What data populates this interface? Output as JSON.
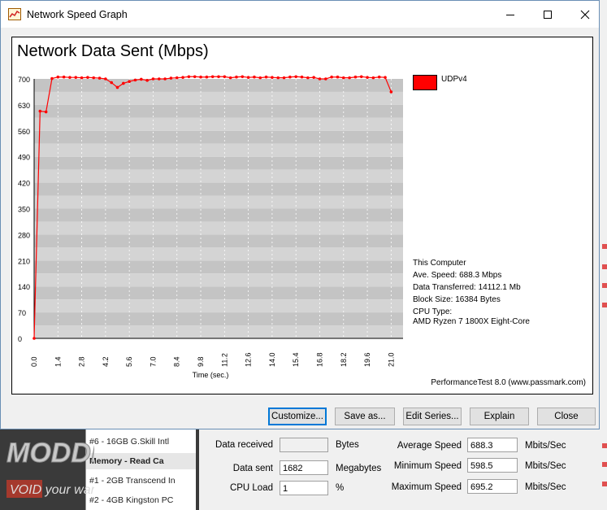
{
  "window": {
    "title": "Network Speed Graph"
  },
  "chart_data": {
    "type": "line",
    "title": "Network Data Sent (Mbps)",
    "xlabel": "Time (sec.)",
    "ylabel": "",
    "xlim": [
      0.0,
      21.7
    ],
    "ylim": [
      0,
      700
    ],
    "x_ticks": [
      "0.0",
      "1.4",
      "2.8",
      "4.2",
      "5.6",
      "7.0",
      "8.4",
      "9.8",
      "11.2",
      "12.6",
      "14.0",
      "15.4",
      "16.8",
      "18.2",
      "19.6",
      "21.0"
    ],
    "y_ticks": [
      "0",
      "70",
      "140",
      "210",
      "280",
      "350",
      "420",
      "490",
      "560",
      "630",
      "700"
    ],
    "grid": true,
    "legend_position": "top-right",
    "series": [
      {
        "name": "UDPv4",
        "color": "#ff0000",
        "x": [
          0.0,
          0.35,
          0.7,
          1.05,
          1.4,
          1.75,
          2.1,
          2.45,
          2.8,
          3.15,
          3.5,
          3.85,
          4.2,
          4.55,
          4.9,
          5.25,
          5.6,
          5.95,
          6.3,
          6.65,
          7.0,
          7.35,
          7.7,
          8.05,
          8.4,
          8.75,
          9.1,
          9.45,
          9.8,
          10.15,
          10.5,
          10.85,
          11.2,
          11.55,
          11.9,
          12.25,
          12.6,
          12.95,
          13.3,
          13.65,
          14.0,
          14.35,
          14.7,
          15.05,
          15.4,
          15.75,
          16.1,
          16.45,
          16.8,
          17.15,
          17.5,
          17.85,
          18.2,
          18.55,
          18.9,
          19.25,
          19.6,
          19.95,
          20.3,
          20.65,
          21.0
        ],
        "values": [
          0,
          613,
          611,
          701,
          705,
          705,
          704,
          704,
          703,
          704,
          703,
          702,
          700,
          690,
          677,
          688,
          693,
          697,
          699,
          696,
          700,
          700,
          700,
          702,
          703,
          704,
          706,
          706,
          705,
          705,
          706,
          706,
          706,
          703,
          705,
          706,
          704,
          705,
          703,
          705,
          704,
          703,
          703,
          705,
          706,
          705,
          703,
          704,
          700,
          700,
          705,
          705,
          703,
          703,
          705,
          706,
          704,
          703,
          705,
          704,
          665
        ]
      }
    ]
  },
  "legend": {
    "label": "UDPv4",
    "color": "#ff0000"
  },
  "info": {
    "computer": "This Computer",
    "avg_speed": "Ave. Speed: 688.3 Mbps",
    "data_transferred": "Data Transferred: 14112.1 Mb",
    "block_size": "Block Size: 16384 Bytes",
    "cpu_type_label": "CPU Type:",
    "cpu_type": "AMD Ryzen 7 1800X Eight-Core"
  },
  "footer_note": "PerformanceTest 8.0 (www.passmark.com)",
  "buttons": {
    "customize": "Customize...",
    "save_as": "Save as...",
    "edit_series": "Edit Series...",
    "explain": "Explain",
    "close": "Close"
  },
  "background": {
    "list_items": [
      "#6 - 16GB G.Skill Intl",
      "Memory - Read Ca",
      "#1 - 2GB Transcend In",
      "#2 - 4GB Kingston PC"
    ],
    "stats": {
      "data_received_label": "Data received",
      "data_received_value": "",
      "data_received_unit": "Bytes",
      "data_sent_label": "Data sent",
      "data_sent_value": "1682",
      "data_sent_unit": "Megabytes",
      "cpu_load_label": "CPU Load",
      "cpu_load_value": "1",
      "cpu_load_unit": "%",
      "avg_speed_label": "Average Speed",
      "avg_speed_value": "688.3",
      "avg_speed_unit": "Mbits/Sec",
      "min_speed_label": "Minimum Speed",
      "min_speed_value": "598.5",
      "min_speed_unit": "Mbits/Sec",
      "max_speed_label": "Maximum Speed",
      "max_speed_value": "695.2",
      "max_speed_unit": "Mbits/Sec"
    },
    "watermark": {
      "line1": "MODDERS",
      "line2": "VOID your warranty"
    }
  }
}
